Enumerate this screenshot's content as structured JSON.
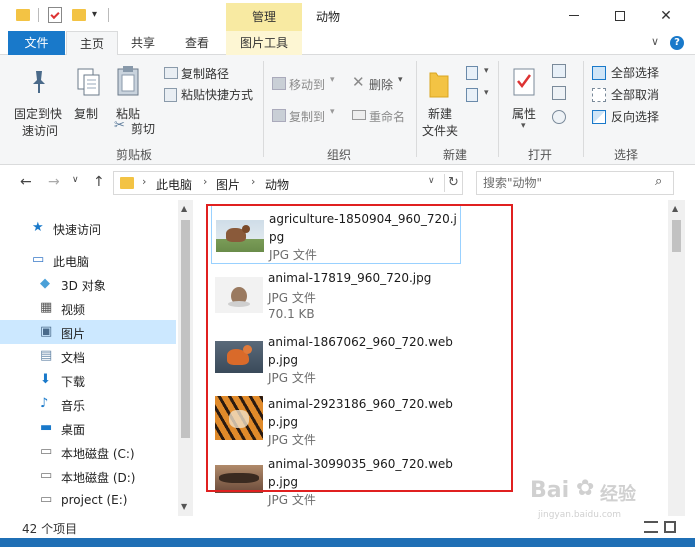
{
  "window": {
    "title": "动物",
    "context_tab": "管理"
  },
  "tabs": {
    "file": "文件",
    "home": "主页",
    "share": "共享",
    "view": "查看",
    "picture_tools": "图片工具"
  },
  "ribbon": {
    "pin_label_1": "固定到快",
    "pin_label_2": "速访问",
    "copy": "复制",
    "paste": "粘贴",
    "copy_path": "复制路径",
    "paste_shortcut": "粘贴快捷方式",
    "cut": "剪切",
    "clipboard_group": "剪贴板",
    "move_to": "移动到",
    "copy_to": "复制到",
    "delete": "删除",
    "rename": "重命名",
    "organize_group": "组织",
    "new_folder_1": "新建",
    "new_folder_2": "文件夹",
    "new_group": "新建",
    "properties": "属性",
    "open_group": "打开",
    "select_all": "全部选择",
    "select_none": "全部取消",
    "invert_selection": "反向选择",
    "select_group": "选择"
  },
  "address": {
    "crumbs": [
      "此电脑",
      "图片",
      "动物"
    ],
    "search_placeholder": "搜索\"动物\""
  },
  "navpane": {
    "items": [
      {
        "label": "快速访问",
        "icon": "star-icon"
      },
      {
        "label": "此电脑",
        "icon": "computer-icon"
      },
      {
        "label": "3D 对象",
        "icon": "cube-icon"
      },
      {
        "label": "视频",
        "icon": "video-icon"
      },
      {
        "label": "图片",
        "icon": "picture-icon"
      },
      {
        "label": "文档",
        "icon": "document-icon"
      },
      {
        "label": "下载",
        "icon": "download-icon"
      },
      {
        "label": "音乐",
        "icon": "music-icon"
      },
      {
        "label": "桌面",
        "icon": "desktop-icon"
      },
      {
        "label": "本地磁盘 (C:)",
        "icon": "drive-icon"
      },
      {
        "label": "本地磁盘 (D:)",
        "icon": "drive-icon"
      },
      {
        "label": "project (E:)",
        "icon": "drive-icon"
      }
    ]
  },
  "files": [
    {
      "name": "agriculture-1850904_960_720.jpg",
      "type": "JPG 文件",
      "size": ""
    },
    {
      "name": "animal-17819_960_720.jpg",
      "type": "JPG 文件",
      "size": "70.1 KB"
    },
    {
      "name": "animal-1867062_960_720.webp.jpg",
      "type": "JPG 文件",
      "size": ""
    },
    {
      "name": "animal-2923186_960_720.webp.jpg",
      "type": "JPG 文件",
      "size": ""
    },
    {
      "name": "animal-3099035_960_720.webp.jpg",
      "type": "JPG 文件",
      "size": ""
    }
  ],
  "status": {
    "count": "42 个项目"
  },
  "colors": {
    "accent": "#1979ca",
    "context_tab": "#f8eaa2",
    "selected_nav": "#cce8ff",
    "highlight": "#e02020"
  }
}
